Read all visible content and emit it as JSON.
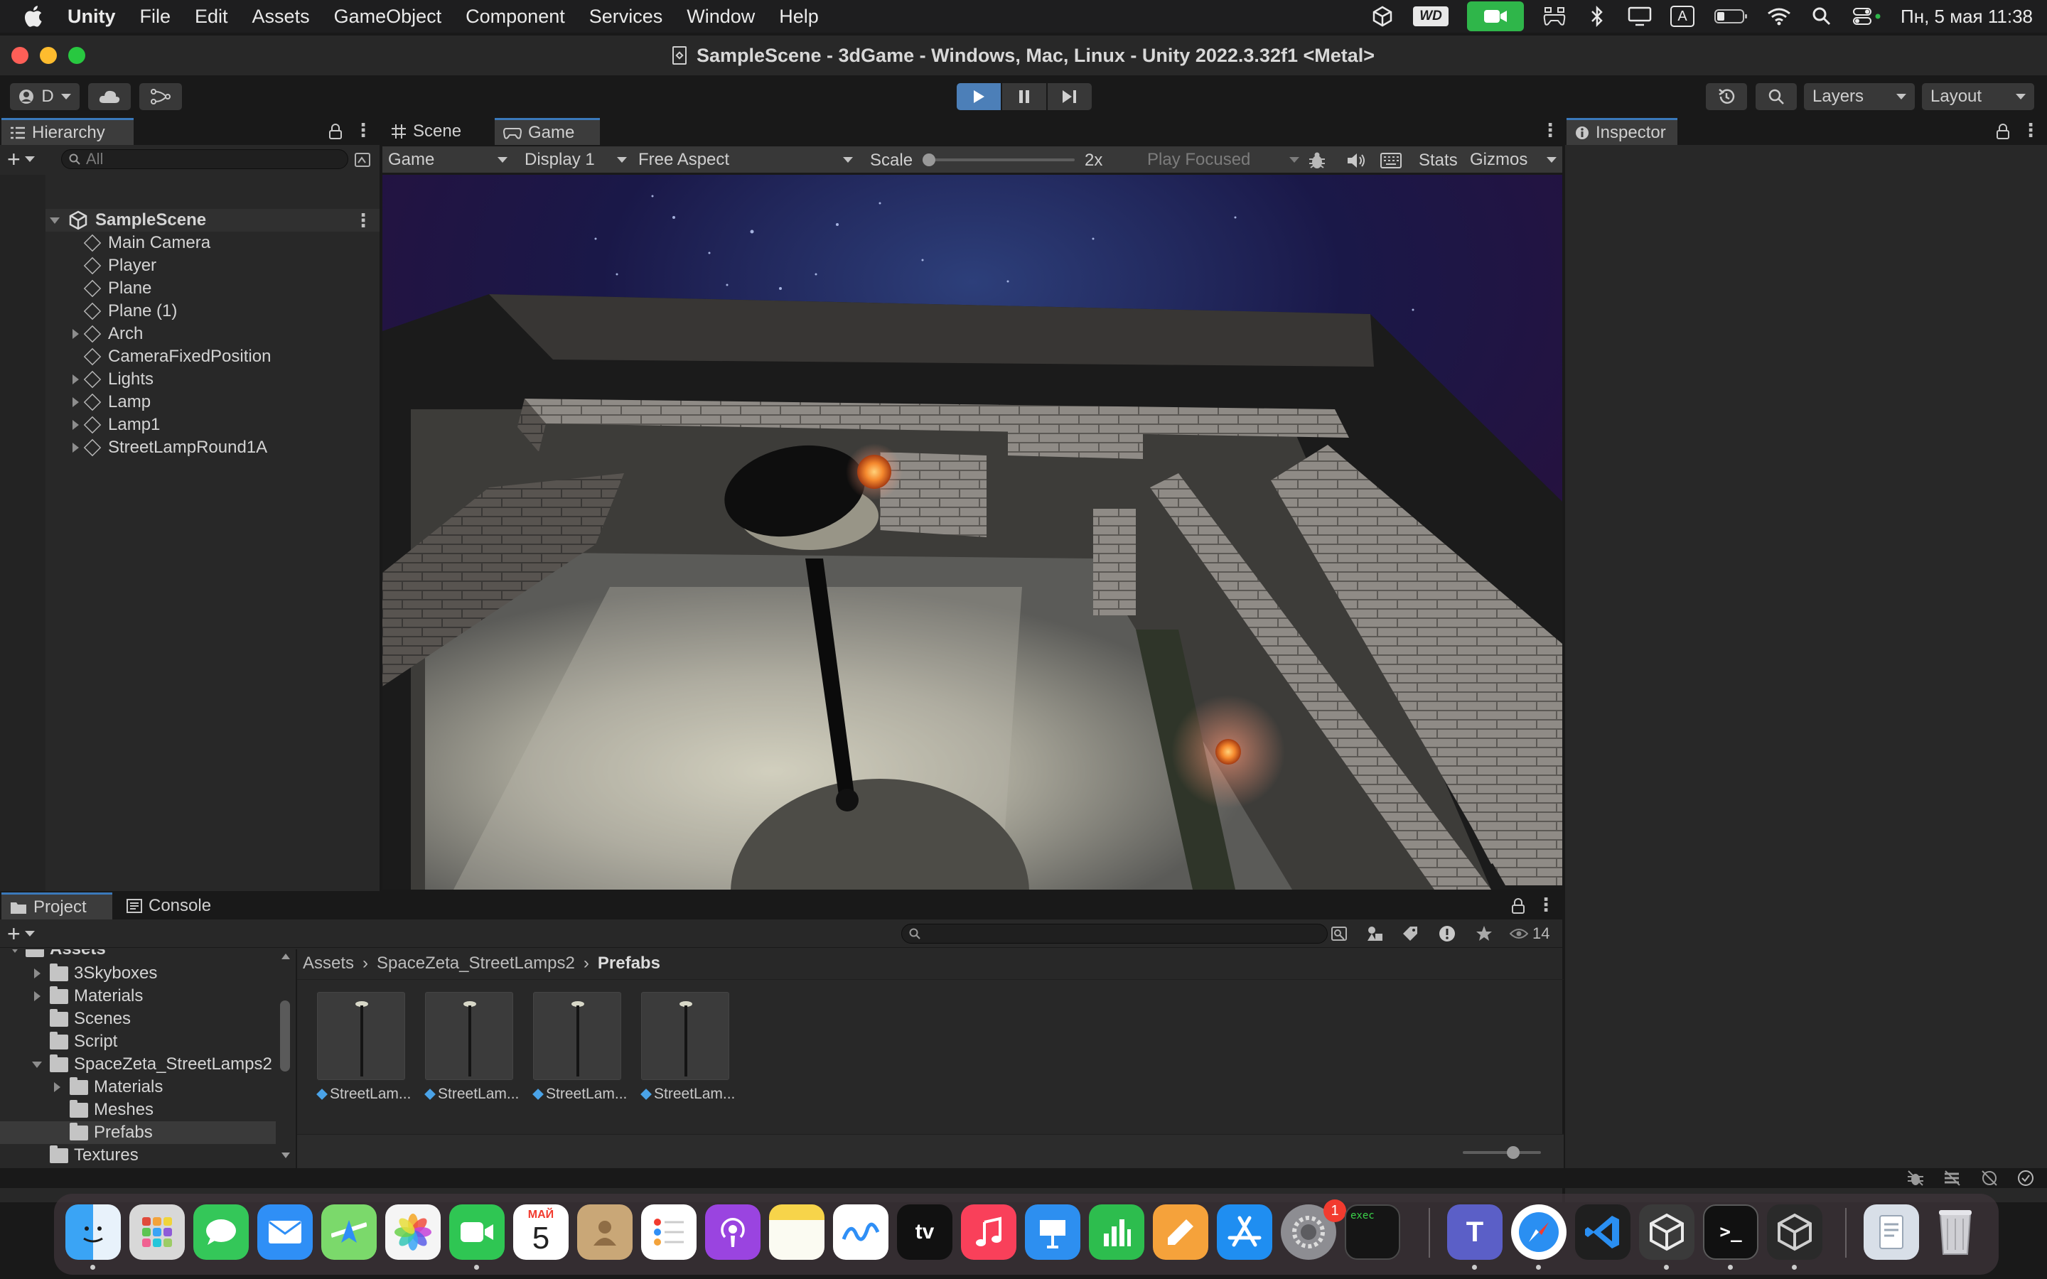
{
  "menubar": {
    "app_name": "Unity",
    "items": [
      "File",
      "Edit",
      "Assets",
      "GameObject",
      "Component",
      "Services",
      "Window",
      "Help"
    ],
    "wd_label": "WD",
    "input_source": "A",
    "datetime": "Пн, 5 мая  11:38"
  },
  "window": {
    "title": "SampleScene - 3dGame - Windows, Mac, Linux - Unity 2022.3.32f1 <Metal>"
  },
  "toolbar": {
    "account_label": "D",
    "layers_label": "Layers",
    "layout_label": "Layout"
  },
  "hierarchy": {
    "tab_label": "Hierarchy",
    "search_placeholder": "All",
    "scene_name": "SampleScene",
    "items": [
      {
        "label": "Main Camera",
        "expandable": false
      },
      {
        "label": "Player",
        "expandable": false
      },
      {
        "label": "Plane",
        "expandable": false
      },
      {
        "label": "Plane (1)",
        "expandable": false
      },
      {
        "label": "Arch",
        "expandable": true
      },
      {
        "label": "CameraFixedPosition",
        "expandable": false
      },
      {
        "label": "Lights",
        "expandable": true
      },
      {
        "label": "Lamp",
        "expandable": true
      },
      {
        "label": "Lamp1",
        "expandable": true
      },
      {
        "label": "StreetLampRound1A",
        "expandable": true
      }
    ]
  },
  "center": {
    "tabs": [
      "Scene",
      "Game"
    ],
    "active_tab": "Game",
    "game_dropdown": "Game",
    "display_dropdown": "Display 1",
    "aspect_dropdown": "Free Aspect",
    "scale_label": "Scale",
    "scale_value": "2x",
    "scale_slider_fraction": 0.0,
    "play_mode_dropdown": "Play Focused",
    "stats_label": "Stats",
    "gizmos_label": "Gizmos"
  },
  "inspector": {
    "tab_label": "Inspector"
  },
  "project": {
    "tabs": [
      "Project",
      "Console"
    ],
    "root_label": "Assets",
    "tree": [
      {
        "label": "3Skyboxes",
        "depth": 1,
        "arrow": "right"
      },
      {
        "label": "Materials",
        "depth": 1,
        "arrow": "right"
      },
      {
        "label": "Scenes",
        "depth": 1,
        "arrow": "none"
      },
      {
        "label": "Script",
        "depth": 1,
        "arrow": "none"
      },
      {
        "label": "SpaceZeta_StreetLamps2",
        "depth": 1,
        "arrow": "down"
      },
      {
        "label": "Materials",
        "depth": 2,
        "arrow": "right"
      },
      {
        "label": "Meshes",
        "depth": 2,
        "arrow": "none"
      },
      {
        "label": "Prefabs",
        "depth": 2,
        "arrow": "none"
      },
      {
        "label": "Textures",
        "depth": 1,
        "arrow": "none"
      }
    ],
    "selected_folder": "Prefabs",
    "breadcrumb": [
      "Assets",
      "SpaceZeta_StreetLamps2",
      "Prefabs"
    ],
    "hidden_count": "14",
    "assets": [
      "StreetLam...",
      "StreetLam...",
      "StreetLam...",
      "StreetLam..."
    ]
  },
  "dock": {
    "calendar_month": "МАЙ",
    "calendar_day": "5",
    "settings_badge": "1",
    "terminal_label": "exec"
  },
  "colors": {
    "accent_blue": "#3a79bb",
    "panel_bg": "#282828",
    "header_bg": "#191919"
  }
}
